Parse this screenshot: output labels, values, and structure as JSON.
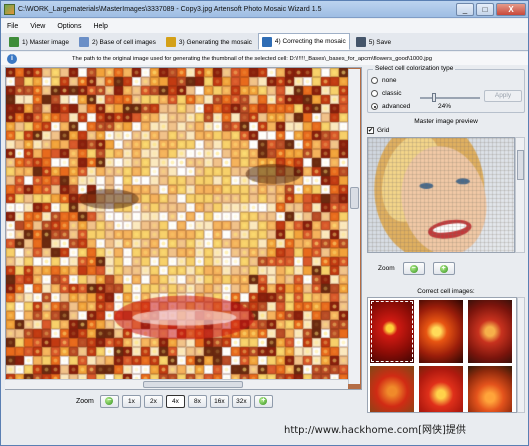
{
  "window": {
    "title": "C:\\WORK_Largematerials\\MasterImages\\3337089 - Copy3.jpg Artensoft Photo Mosaic Wizard 1.5",
    "minimize": "_",
    "maximize": "□",
    "close": "X"
  },
  "menu": [
    "File",
    "View",
    "Options",
    "Help"
  ],
  "tabs": [
    {
      "label": "1) Master image",
      "color": "#3f8d3a"
    },
    {
      "label": "2) Base of cell images",
      "color": "#6b8fc7"
    },
    {
      "label": "3) Generating the mosaic",
      "color": "#d4a017"
    },
    {
      "label": "4) Correcting the mosaic",
      "color": "#2f6db5",
      "active": true
    },
    {
      "label": "5) Save",
      "color": "#45556a"
    }
  ],
  "info": {
    "text": "The path to the original image used for generating the thumbnail of the selected cell: D:\\!!!!!_Bases\\_bases_for_apcm\\flowers_good\\1000.jpg"
  },
  "zoom": {
    "label": "Zoom",
    "levels": [
      "1x",
      "2x",
      "4x",
      "8x",
      "16x",
      "32x"
    ],
    "selected": "4x",
    "minus": "−",
    "plus": "+"
  },
  "colorization": {
    "title": "Select cell colorization type",
    "options": [
      "none",
      "classic",
      "advanced"
    ],
    "selected": "advanced",
    "percent": "24%",
    "level": 0.24,
    "apply": "Apply"
  },
  "preview": {
    "title": "Master image preview",
    "grid_label": "Grid",
    "grid_checked": "✔",
    "zoom_label": "Zoom"
  },
  "correct_cells": {
    "title": "Correct cell images:"
  },
  "watermark": "http://www.hackhome.com[网侠]提供"
}
